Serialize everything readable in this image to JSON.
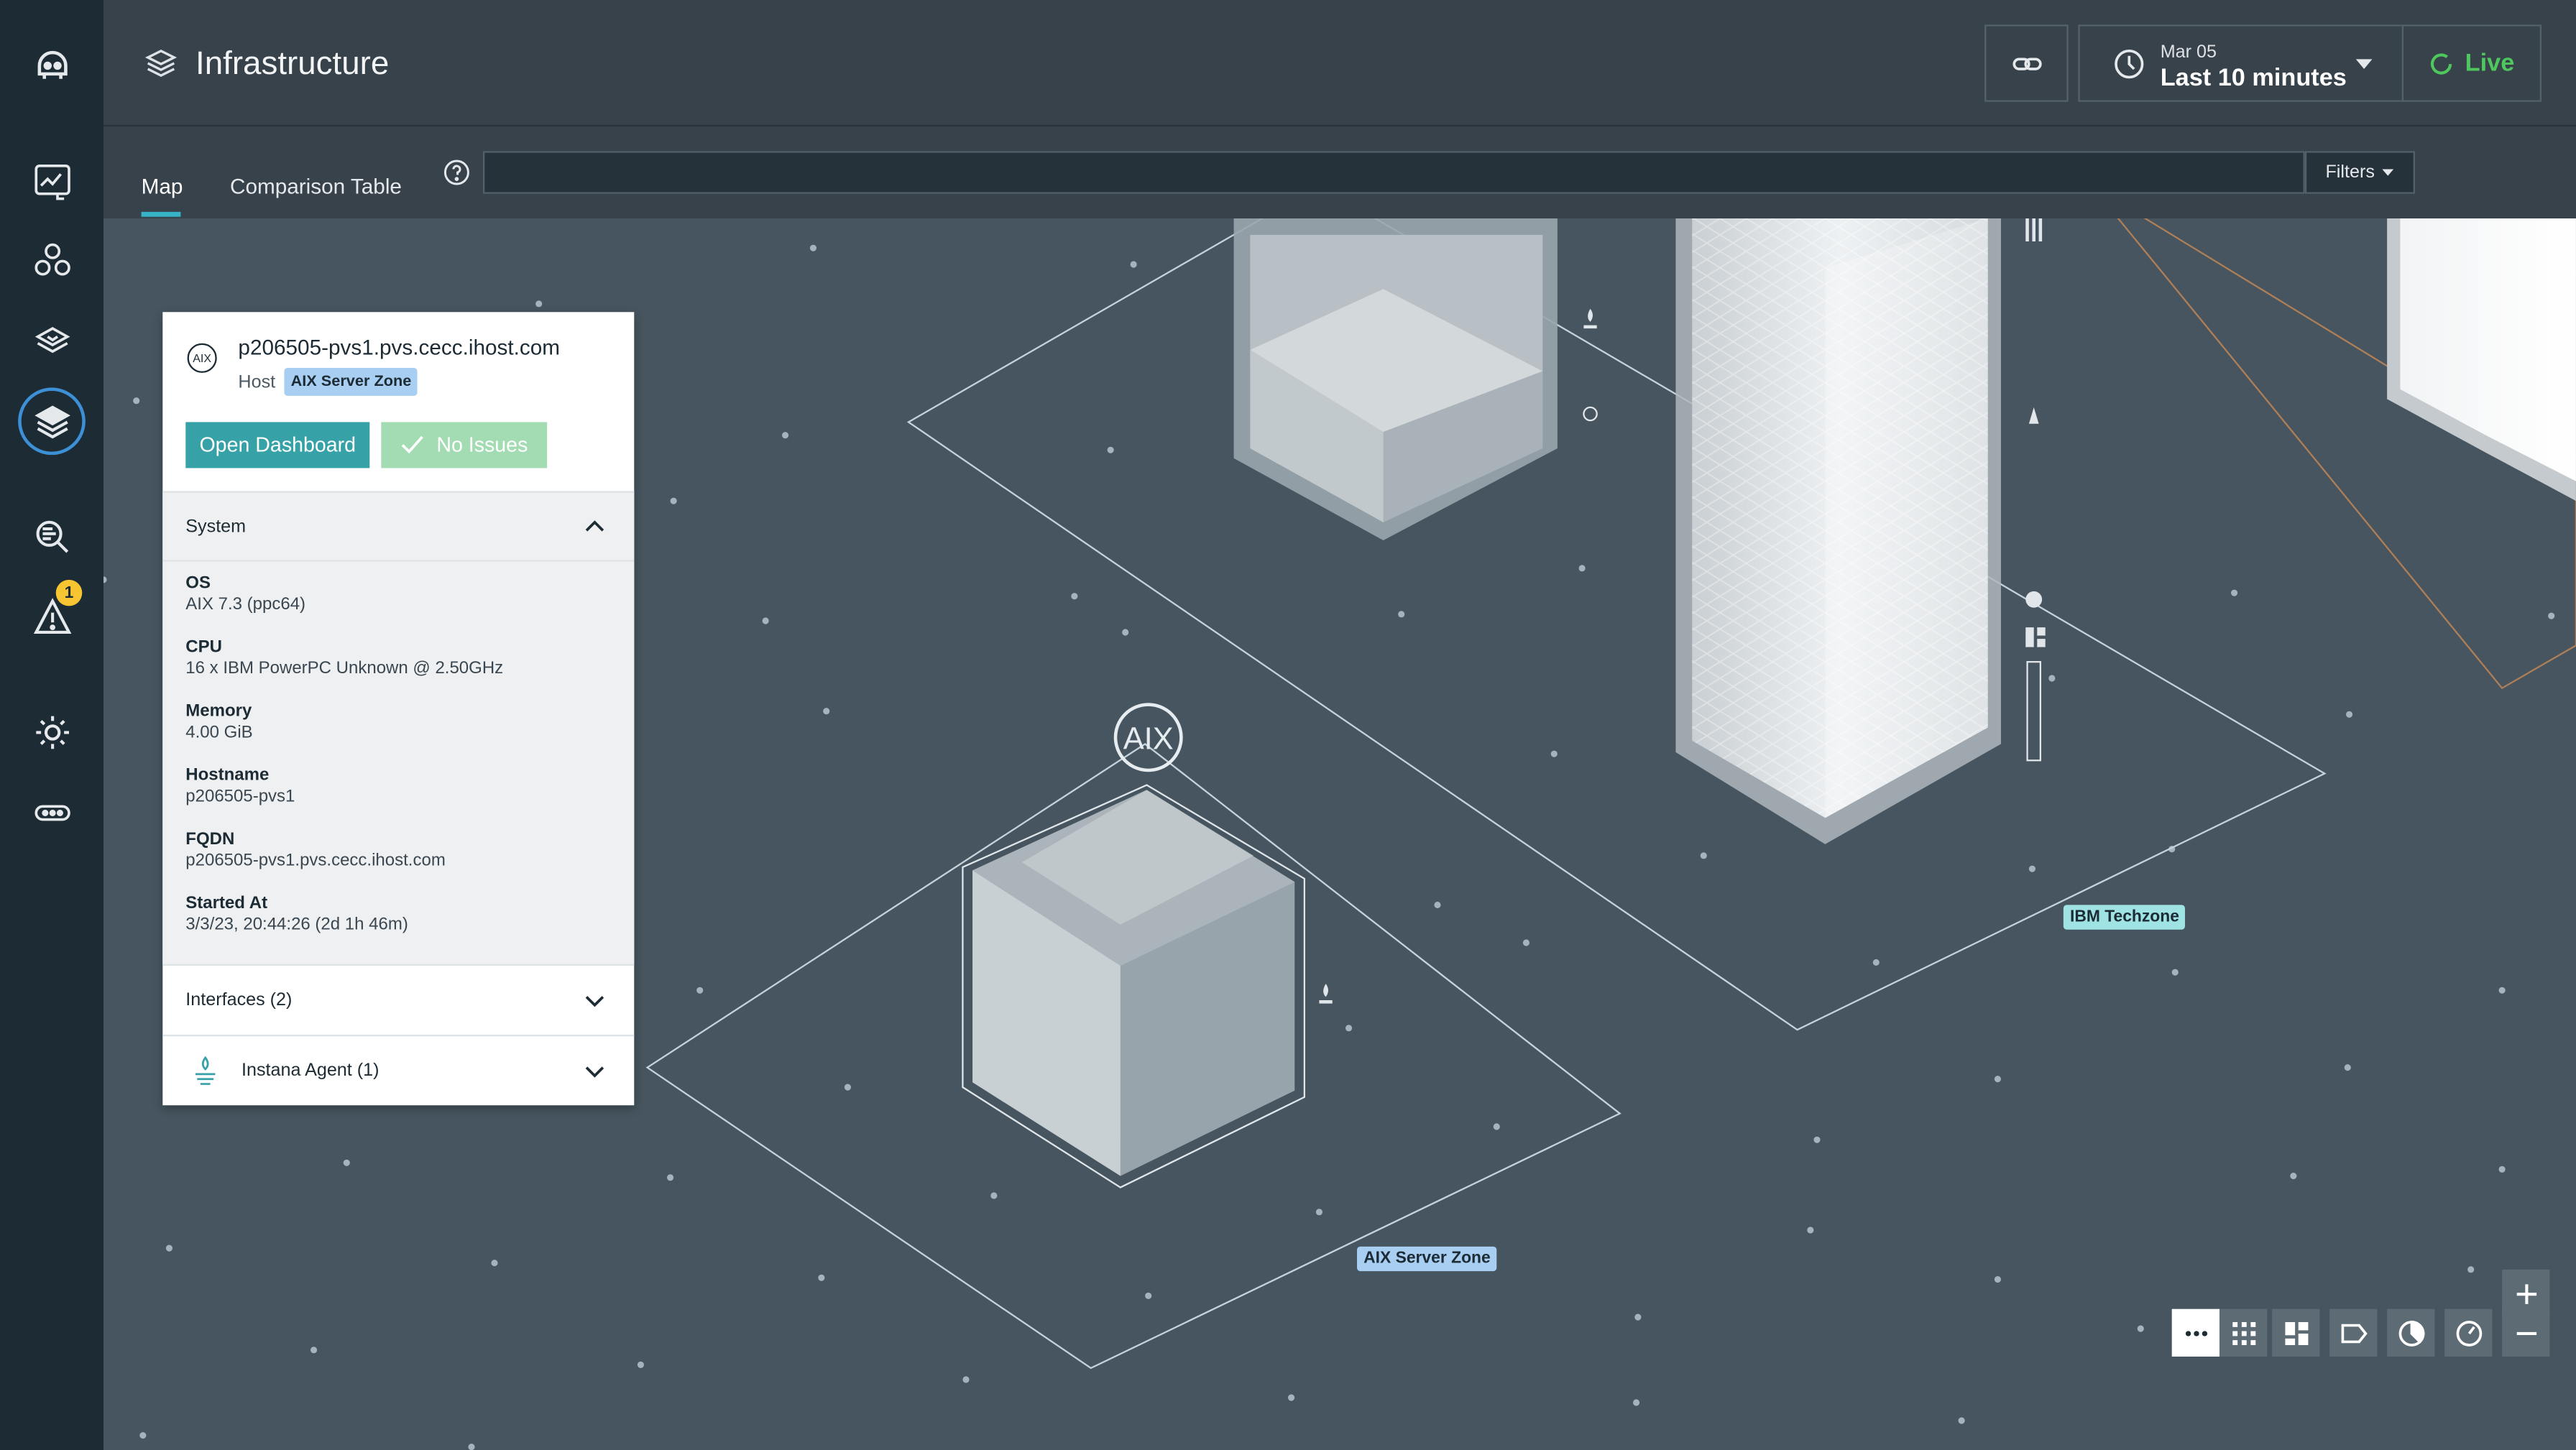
{
  "header": {
    "title": "Infrastructure",
    "time_date": "Mar 05",
    "time_range": "Last 10 minutes",
    "live_label": "Live"
  },
  "nav": {
    "items": [
      {
        "name": "logo-icon"
      },
      {
        "name": "dashboard-icon"
      },
      {
        "name": "applications-icon"
      },
      {
        "name": "websites-icon"
      },
      {
        "name": "infrastructure-icon"
      },
      {
        "name": "analytics-icon"
      },
      {
        "name": "events-icon"
      },
      {
        "name": "settings-icon"
      },
      {
        "name": "more-icon"
      }
    ],
    "events_badge": "1"
  },
  "tabs": {
    "map": "Map",
    "comparison": "Comparison Table",
    "search_value": "",
    "filters": "Filters"
  },
  "map": {
    "big_label": "AIX",
    "zones": {
      "aix": "AIX Server Zone",
      "ibm": "IBM Techzone"
    }
  },
  "panel": {
    "host_name": "p206505-pvs1.pvs.cecc.ihost.com",
    "entity_type": "Host",
    "zone_tag": "AIX Server Zone",
    "open_dashboard": "Open Dashboard",
    "no_issues": "No Issues",
    "system_section": "System",
    "system": [
      {
        "label": "OS",
        "value": "AIX 7.3 (ppc64)"
      },
      {
        "label": "CPU",
        "value": "16 x IBM PowerPC Unknown @ 2.50GHz"
      },
      {
        "label": "Memory",
        "value": "4.00 GiB"
      },
      {
        "label": "Hostname",
        "value": "p206505-pvs1"
      },
      {
        "label": "FQDN",
        "value": "p206505-pvs1.pvs.cecc.ihost.com"
      },
      {
        "label": "Started At",
        "value": "3/3/23, 20:44:26 (2d 1h 46m)"
      }
    ],
    "interfaces_section": "Interfaces (2)",
    "agent_section": "Instana Agent (1)"
  },
  "colors": {
    "accent": "#37b3c8",
    "live": "#4ec85e",
    "map_bg": "#46555f",
    "aix_zone": "#a8cef2",
    "ibm_zone": "#9fe3e4"
  }
}
